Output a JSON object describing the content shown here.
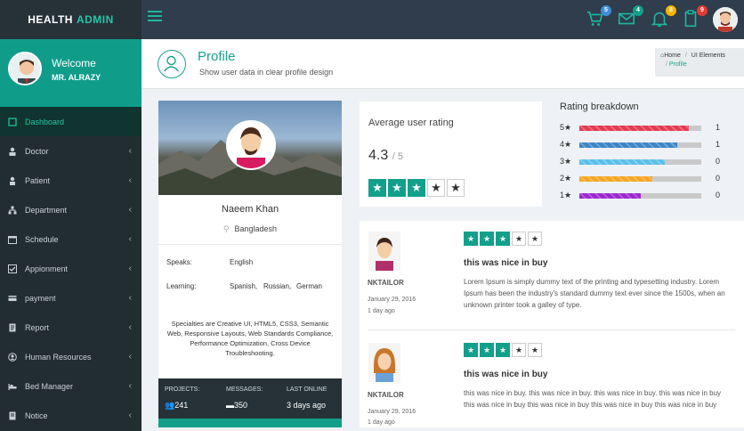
{
  "app": {
    "brand_1": "HEALTH",
    "brand_2": "ADMIN"
  },
  "topbar": {
    "badges": [
      {
        "icon": "cart-icon",
        "count": "5",
        "color": "#3d8fd6"
      },
      {
        "icon": "mail-icon",
        "count": "4",
        "color": "#12a08b"
      },
      {
        "icon": "bell-icon",
        "count": "8",
        "color": "#f5b400"
      },
      {
        "icon": "clipboard-icon",
        "count": "9",
        "color": "#e53935"
      }
    ]
  },
  "welcome": {
    "greeting": "Welcome",
    "user": "MR. ALRAZY"
  },
  "sidebar": {
    "items": [
      {
        "label": "Dashboard",
        "icon": "dashboard-icon"
      },
      {
        "label": "Doctor",
        "icon": "doctor-icon"
      },
      {
        "label": "Patient",
        "icon": "patient-icon"
      },
      {
        "label": "Department",
        "icon": "department-icon"
      },
      {
        "label": "Schedule",
        "icon": "schedule-icon"
      },
      {
        "label": "Appionment",
        "icon": "appointment-icon"
      },
      {
        "label": "payment",
        "icon": "payment-icon"
      },
      {
        "label": "Report",
        "icon": "report-icon"
      },
      {
        "label": "Human Resources",
        "icon": "human-resources-icon"
      },
      {
        "label": "Bed Manager",
        "icon": "bed-icon"
      },
      {
        "label": "Notice",
        "icon": "notice-icon"
      }
    ]
  },
  "page": {
    "title": "Profile",
    "subtitle": "Show user data in clear profile design"
  },
  "breadcrumb": {
    "home": "Home",
    "section": "UI Elements",
    "current": "Profile"
  },
  "profile": {
    "name": "Naeem Khan",
    "location": "Bangladesh",
    "speaks_label": "Speaks:",
    "speaks": "English",
    "learning_label": "Learning:",
    "learning": [
      "Spanish,",
      "Russian,",
      "German"
    ],
    "specialties": "Specialties are Creative UI, HTML5, CSS3, Semantic Web, Responsive Layouts, Web Standards Compliance, Performance Optimization, Cross Device Troubleshooting.",
    "stats": [
      {
        "label": "PROJECTS:",
        "value": "241",
        "icon": "users-icon"
      },
      {
        "label": "MESSAGES:",
        "value": "350",
        "icon": "message-icon"
      },
      {
        "label": "LAST ONLINE",
        "value": "3 days ago",
        "icon": ""
      }
    ]
  },
  "rating": {
    "title": "Average user rating",
    "value": "4.3",
    "max": "/ 5",
    "stars_on": 3,
    "stars_total": 5
  },
  "breakdown": {
    "title": "Rating breakdown",
    "rows": [
      {
        "label": "5",
        "count": "1",
        "fraction": 0.9,
        "color": "#e53950"
      },
      {
        "label": "4",
        "count": "1",
        "fraction": 0.8,
        "color": "#3d86c6"
      },
      {
        "label": "3",
        "count": "0",
        "fraction": 0.7,
        "color": "#5bc0e8"
      },
      {
        "label": "2",
        "count": "0",
        "fraction": 0.6,
        "color": "#f5a623"
      },
      {
        "label": "1",
        "count": "0",
        "fraction": 0.5,
        "color": "#9c27d0"
      }
    ]
  },
  "reviews": [
    {
      "name": "NKTAILOR",
      "date": "January 29, 2016",
      "ago": "1 day ago",
      "title": "this was nice in buy",
      "stars": 3,
      "text": "Lorem Ipsum is simply dummy text of the printing and typesetting industry. Lorem Ipsum has been the industry's standard dummy text ever since the 1500s, when an unknown printer took a galley of type."
    },
    {
      "name": "NKTAILOR",
      "date": "January 29, 2016",
      "ago": "1 day ago",
      "title": "this was nice in buy",
      "stars": 3,
      "text": "this was nice in buy. this was nice in buy. this was nice in buy. this was nice in buy this was nice in buy this was nice in buy this was nice in buy this was nice in buy"
    }
  ]
}
